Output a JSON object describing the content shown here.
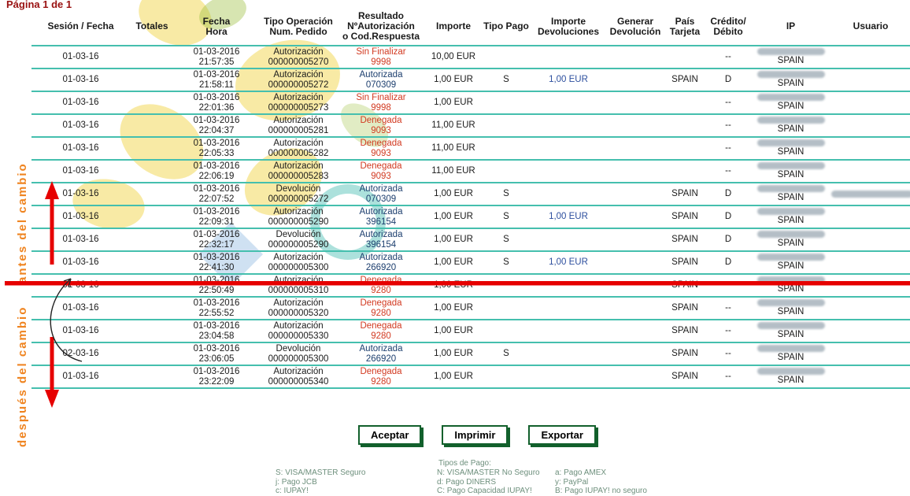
{
  "page": {
    "indicator": "Página 1 de 1"
  },
  "annotations": {
    "before_label": "antes del cambio",
    "after_label": "después del cambio"
  },
  "table": {
    "headers": [
      [
        "Sesión / Fecha"
      ],
      [
        "Totales"
      ],
      [
        "Fecha",
        "Hora"
      ],
      [
        "Tipo Operación",
        "Num. Pedido"
      ],
      [
        "Resultado",
        "NºAutorización",
        "o Cod.Respuesta"
      ],
      [
        "Importe"
      ],
      [
        "Tipo Pago"
      ],
      [
        "Importe",
        "Devoluciones"
      ],
      [
        "Generar",
        "Devolución"
      ],
      [
        "País",
        "Tarjeta"
      ],
      [
        "Crédito/",
        "Débito"
      ],
      [
        "IP"
      ],
      [
        "Usuario"
      ]
    ],
    "rows": [
      {
        "session": "01-03-16",
        "totales": "",
        "fecha": "01-03-2016",
        "hora": "21:57:35",
        "tipo": "Autorización",
        "pedido": "000000005270",
        "resultado": "Sin Finalizar",
        "codigo": "9998",
        "result_class": "res-red",
        "importe": "10,00 EUR",
        "tipo_pago": "",
        "importe_dev": "",
        "pais": "",
        "credito": "--",
        "ip_country": "SPAIN",
        "ip_redacted": true,
        "user_redacted": false
      },
      {
        "session": "01-03-16",
        "totales": "",
        "fecha": "01-03-2016",
        "hora": "21:58:11",
        "tipo": "Autorización",
        "pedido": "000000005272",
        "resultado": "Autorizada",
        "codigo": "070309",
        "result_class": "res-blue",
        "importe": "1,00 EUR",
        "tipo_pago": "S",
        "importe_dev": "1,00 EUR",
        "pais": "SPAIN",
        "credito": "D",
        "ip_country": "SPAIN",
        "ip_redacted": true,
        "user_redacted": false
      },
      {
        "session": "01-03-16",
        "totales": "",
        "fecha": "01-03-2016",
        "hora": "22:01:36",
        "tipo": "Autorización",
        "pedido": "000000005273",
        "resultado": "Sin Finalizar",
        "codigo": "9998",
        "result_class": "res-red",
        "importe": "1,00 EUR",
        "tipo_pago": "",
        "importe_dev": "",
        "pais": "",
        "credito": "--",
        "ip_country": "SPAIN",
        "ip_redacted": true,
        "user_redacted": false
      },
      {
        "session": "01-03-16",
        "totales": "",
        "fecha": "01-03-2016",
        "hora": "22:04:37",
        "tipo": "Autorización",
        "pedido": "000000005281",
        "resultado": "Denegada",
        "codigo": "9093",
        "result_class": "res-red",
        "importe": "11,00 EUR",
        "tipo_pago": "",
        "importe_dev": "",
        "pais": "",
        "credito": "--",
        "ip_country": "SPAIN",
        "ip_redacted": true,
        "user_redacted": false
      },
      {
        "session": "01-03-16",
        "totales": "",
        "fecha": "01-03-2016",
        "hora": "22:05:33",
        "tipo": "Autorización",
        "pedido": "000000005282",
        "resultado": "Denegada",
        "codigo": "9093",
        "result_class": "res-red",
        "importe": "11,00 EUR",
        "tipo_pago": "",
        "importe_dev": "",
        "pais": "",
        "credito": "--",
        "ip_country": "SPAIN",
        "ip_redacted": true,
        "user_redacted": false
      },
      {
        "session": "01-03-16",
        "totales": "",
        "fecha": "01-03-2016",
        "hora": "22:06:19",
        "tipo": "Autorización",
        "pedido": "000000005283",
        "resultado": "Denegada",
        "codigo": "9093",
        "result_class": "res-red",
        "importe": "11,00 EUR",
        "tipo_pago": "",
        "importe_dev": "",
        "pais": "",
        "credito": "--",
        "ip_country": "SPAIN",
        "ip_redacted": true,
        "user_redacted": false
      },
      {
        "session": "01-03-16",
        "totales": "",
        "fecha": "01-03-2016",
        "hora": "22:07:52",
        "tipo": "Devolución",
        "pedido": "000000005272",
        "resultado": "Autorizada",
        "codigo": "070309",
        "result_class": "res-blue",
        "importe": "1,00 EUR",
        "tipo_pago": "S",
        "importe_dev": "",
        "pais": "SPAIN",
        "credito": "D",
        "ip_country": "SPAIN",
        "ip_redacted": true,
        "user_redacted": true
      },
      {
        "session": "01-03-16",
        "totales": "",
        "fecha": "01-03-2016",
        "hora": "22:09:31",
        "tipo": "Autorización",
        "pedido": "000000005290",
        "resultado": "Autorizada",
        "codigo": "396154",
        "result_class": "res-blue",
        "importe": "1,00 EUR",
        "tipo_pago": "S",
        "importe_dev": "1,00 EUR",
        "pais": "SPAIN",
        "credito": "D",
        "ip_country": "SPAIN",
        "ip_redacted": true,
        "user_redacted": false
      },
      {
        "session": "01-03-16",
        "totales": "",
        "fecha": "01-03-2016",
        "hora": "22:32:17",
        "tipo": "Devolución",
        "pedido": "000000005290",
        "resultado": "Autorizada",
        "codigo": "396154",
        "result_class": "res-blue",
        "importe": "1,00 EUR",
        "tipo_pago": "S",
        "importe_dev": "",
        "pais": "SPAIN",
        "credito": "D",
        "ip_country": "SPAIN",
        "ip_redacted": true,
        "user_redacted": false
      },
      {
        "session": "01-03-16",
        "totales": "",
        "fecha": "01-03-2016",
        "hora": "22:41:30",
        "tipo": "Autorización",
        "pedido": "000000005300",
        "resultado": "Autorizada",
        "codigo": "266920",
        "result_class": "res-blue",
        "importe": "1,00 EUR",
        "tipo_pago": "S",
        "importe_dev": "1,00 EUR",
        "pais": "SPAIN",
        "credito": "D",
        "ip_country": "SPAIN",
        "ip_redacted": true,
        "user_redacted": false
      },
      {
        "session": "01-03-16",
        "totales": "",
        "fecha": "01-03-2016",
        "hora": "22:50:49",
        "tipo": "Autorización",
        "pedido": "000000005310",
        "resultado": "Denegada",
        "codigo": "9280",
        "result_class": "res-red",
        "importe": "1,00 EUR",
        "tipo_pago": "",
        "importe_dev": "",
        "pais": "SPAIN",
        "credito": "--",
        "ip_country": "SPAIN",
        "ip_redacted": true,
        "user_redacted": false
      },
      {
        "session": "01-03-16",
        "totales": "",
        "fecha": "01-03-2016",
        "hora": "22:55:52",
        "tipo": "Autorización",
        "pedido": "000000005320",
        "resultado": "Denegada",
        "codigo": "9280",
        "result_class": "res-red",
        "importe": "1,00 EUR",
        "tipo_pago": "",
        "importe_dev": "",
        "pais": "SPAIN",
        "credito": "--",
        "ip_country": "SPAIN",
        "ip_redacted": true,
        "user_redacted": false
      },
      {
        "session": "01-03-16",
        "totales": "",
        "fecha": "01-03-2016",
        "hora": "23:04:58",
        "tipo": "Autorización",
        "pedido": "000000005330",
        "resultado": "Denegada",
        "codigo": "9280",
        "result_class": "res-red",
        "importe": "1,00 EUR",
        "tipo_pago": "",
        "importe_dev": "",
        "pais": "SPAIN",
        "credito": "--",
        "ip_country": "SPAIN",
        "ip_redacted": true,
        "user_redacted": false
      },
      {
        "session": "02-03-16",
        "totales": "",
        "fecha": "01-03-2016",
        "hora": "23:06:05",
        "tipo": "Devolución",
        "pedido": "000000005300",
        "resultado": "Autorizada",
        "codigo": "266920",
        "result_class": "res-blue",
        "importe": "1,00 EUR",
        "tipo_pago": "S",
        "importe_dev": "",
        "pais": "SPAIN",
        "credito": "--",
        "ip_country": "SPAIN",
        "ip_redacted": true,
        "user_redacted": false
      },
      {
        "session": "01-03-16",
        "totales": "",
        "fecha": "01-03-2016",
        "hora": "23:22:09",
        "tipo": "Autorización",
        "pedido": "000000005340",
        "resultado": "Denegada",
        "codigo": "9280",
        "result_class": "res-red",
        "importe": "1,00 EUR",
        "tipo_pago": "",
        "importe_dev": "",
        "pais": "SPAIN",
        "credito": "--",
        "ip_country": "SPAIN",
        "ip_redacted": true,
        "user_redacted": false
      }
    ]
  },
  "buttons": [
    {
      "label": "Aceptar"
    },
    {
      "label": "Imprimir"
    },
    {
      "label": "Exportar"
    }
  ],
  "legend": {
    "title": "Tipos de Pago:",
    "columns": [
      [
        "S: VISA/MASTER Seguro",
        "j: Pago JCB",
        "c: IUPAY!"
      ],
      [
        "N: VISA/MASTER No Seguro",
        "d: Pago DINERS",
        "C: Pago Capacidad IUPAY!"
      ],
      [
        "a: Pago AMEX",
        "y: PayPal",
        "B: Pago IUPAY! no seguro"
      ]
    ]
  },
  "colors": {
    "teal": "#45bfae",
    "red-annotation": "#e60000",
    "orange-annotation": "#ef8420",
    "maroon": "#991111",
    "result-red": "#d23a21",
    "result-blue": "#1c3e6e",
    "link-blue": "#2d4f9e",
    "button-green": "#12602c",
    "legend-green": "#6d8f7c",
    "watermark-yellow": "#f2d64b",
    "watermark-teal": "#2fb3a8",
    "watermark-blue": "#a8c8e8",
    "watermark-green": "#9bbf3b",
    "text": "#1a1a1a"
  }
}
